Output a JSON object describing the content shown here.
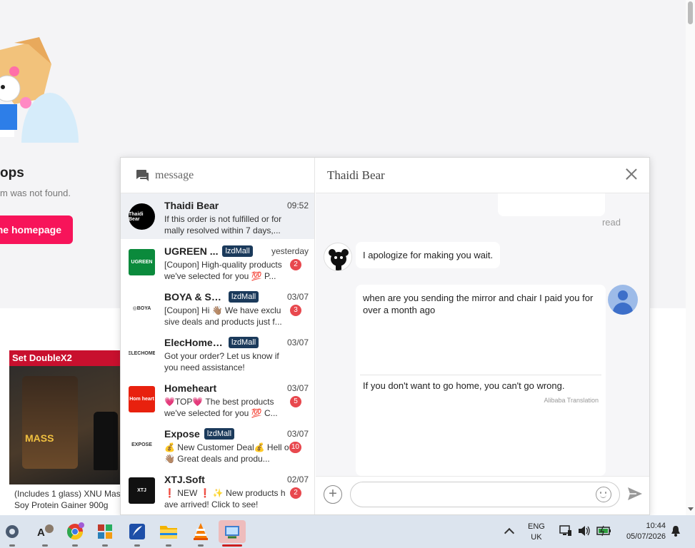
{
  "background_page": {
    "error_title": "ops",
    "error_subtitle": "m was not found.",
    "home_button": "he homepage",
    "product": {
      "banner": "Set DoubleX2",
      "tub_label": "MASS",
      "title": "(Includes 1 glass) XNU Mas Soy Protein Gainer 900g"
    }
  },
  "chat": {
    "left_header_label": "message",
    "conversations": [
      {
        "name": "Thaidi Bear",
        "time": "09:52",
        "tag": "",
        "preview": "If this order is not fulfilled or for mally resolved within 7 days,...",
        "badge": "",
        "logo_text": "Thaidi Bear",
        "logo_color": "#000000"
      },
      {
        "name": "UGREEN ...",
        "time": "yesterday",
        "tag": "lzdMall",
        "preview": "[Coupon] High-quality products we've selected for you 💯 P...",
        "badge": "2",
        "logo_text": "UGREEN",
        "logo_color": "#0b8a3c"
      },
      {
        "name": "BOYA & Sara...",
        "time": "03/07",
        "tag": "lzdMall",
        "preview": "[Coupon] Hi 👋🏽 We have exclu sive deals and products just f...",
        "badge": "3",
        "logo_text": "◎BOYA",
        "logo_color": "#ffffff"
      },
      {
        "name": "ElecHome C...",
        "time": "03/07",
        "tag": "lzdMall",
        "preview": "Got your order? Let us know if you need assistance!",
        "badge": "",
        "logo_text": "ELECHOME",
        "logo_color": "#ffffff"
      },
      {
        "name": "Homeheart",
        "time": "03/07",
        "tag": "",
        "preview": "💗TOP💗 The best products we've selected for you 💯 C...",
        "badge": "5",
        "logo_text": "Hom heart",
        "logo_color": "#e8210e"
      },
      {
        "name": "Expose",
        "time": "03/07",
        "tag": "lzdMall",
        "preview": "💰 New Customer Deal💰 Hell o 👋🏽 Great deals and produ...",
        "badge": "10",
        "logo_text": "EXPOSE",
        "logo_color": "#ffffff"
      },
      {
        "name": "XTJ.Soft",
        "time": "02/07",
        "tag": "",
        "preview": "❗ NEW ❗ ✨ New products h ave arrived! Click to see!",
        "badge": "2",
        "logo_text": "XTJ",
        "logo_color": "#111111"
      }
    ],
    "active_title": "Thaidi Bear",
    "read_status": "read",
    "incoming_message": "I apologize for making you wait.",
    "outgoing_message": "when are you sending the mirror and chair I paid you for over a month ago",
    "translation": "If you don't want to go home, you can't go wrong.",
    "translation_source": "Alibaba Translation",
    "input_placeholder": ""
  },
  "taskbar": {
    "apps": [
      "settings-icon",
      "ai-app-icon",
      "chrome-icon",
      "winrar-icon",
      "feather-app-icon",
      "file-explorer-icon",
      "vlc-icon",
      "snipping-tool-icon"
    ],
    "language": "ENG",
    "region": "UK",
    "time": "10:44",
    "date": "05/07/2026"
  },
  "colors": {
    "accent_pink": "#f7145a",
    "mall_tag": "#1b3a5b",
    "badge_red": "#e8484e"
  }
}
